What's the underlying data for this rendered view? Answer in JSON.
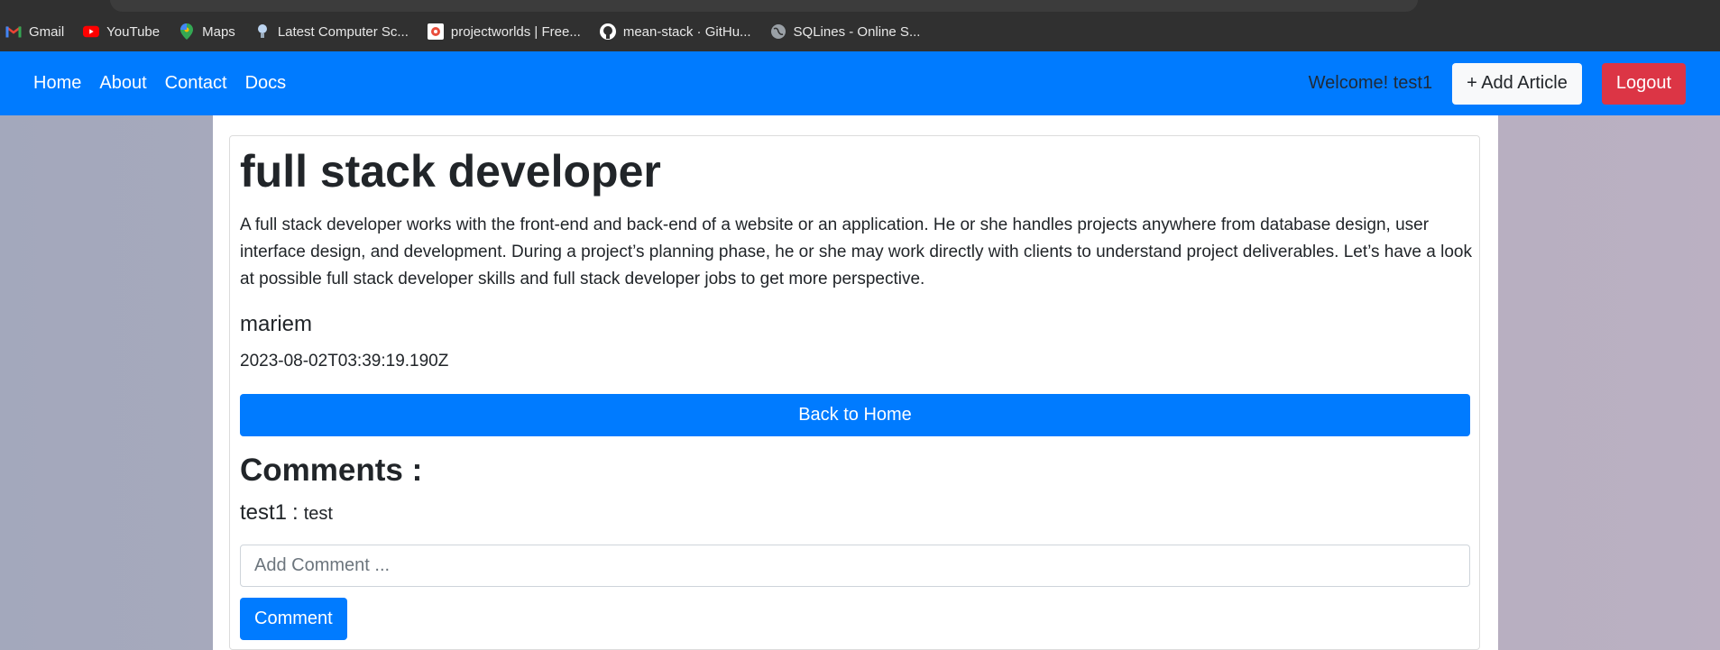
{
  "bookmarks": [
    {
      "label": "Gmail",
      "icon": "gmail-icon"
    },
    {
      "label": "YouTube",
      "icon": "youtube-icon"
    },
    {
      "label": "Maps",
      "icon": "maps-icon"
    },
    {
      "label": "Latest Computer Sc...",
      "icon": "lightbulb-icon"
    },
    {
      "label": "projectworlds | Free...",
      "icon": "projectworlds-icon"
    },
    {
      "label": "mean-stack · GitHu...",
      "icon": "github-icon"
    },
    {
      "label": "SQLines - Online S...",
      "icon": "globe-icon"
    }
  ],
  "navbar": {
    "links": [
      "Home",
      "About",
      "Contact",
      "Docs"
    ],
    "welcome": "Welcome! test1",
    "add_article": "+ Add Article",
    "logout": "Logout"
  },
  "article": {
    "title": "full stack developer",
    "description": "A full stack developer works with the front-end and back-end of a website or an application. He or she handles projects anywhere from database design, user interface design, and development. During a project’s planning phase, he or she may work directly with clients to understand project deliverables. Let’s have a look at possible full stack developer skills and full stack developer jobs to get more perspective.",
    "author": "mariem",
    "date": "2023-08-02T03:39:19.190Z",
    "back_button": "Back to Home"
  },
  "comments": {
    "title": "Comments :",
    "items": [
      {
        "user": "test1",
        "separator": ":",
        "text": "test"
      }
    ],
    "input_placeholder": "Add Comment ...",
    "submit": "Comment"
  },
  "colors": {
    "primary": "#007bff",
    "danger": "#dc3545",
    "light": "#f8f9fa"
  }
}
